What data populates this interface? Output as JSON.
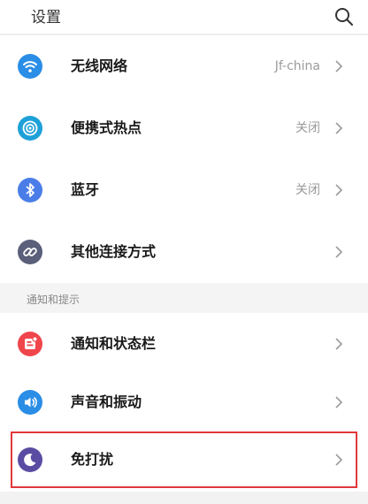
{
  "header": {
    "title": "设置",
    "search_icon": "search-icon"
  },
  "connectivity": [
    {
      "label": "无线网络",
      "value": "Jf-china",
      "icon": "wifi-icon",
      "color": "#2a8de6"
    },
    {
      "label": "便携式热点",
      "value": "关闭",
      "icon": "hotspot-icon",
      "color": "#1ea0d8"
    },
    {
      "label": "蓝牙",
      "value": "关闭",
      "icon": "bluetooth-icon",
      "color": "#4a7de8"
    },
    {
      "label": "其他连接方式",
      "value": "",
      "icon": "link-icon",
      "color": "#5a5f7a"
    }
  ],
  "notifications_section": {
    "title": "通知和提示",
    "items": [
      {
        "label": "通知和状态栏",
        "value": "",
        "icon": "notification-icon",
        "color": "#f0454b"
      },
      {
        "label": "声音和振动",
        "value": "",
        "icon": "sound-icon",
        "color": "#2a8de6"
      },
      {
        "label": "免打扰",
        "value": "",
        "icon": "moon-icon",
        "color": "#5b4ca3"
      }
    ]
  }
}
